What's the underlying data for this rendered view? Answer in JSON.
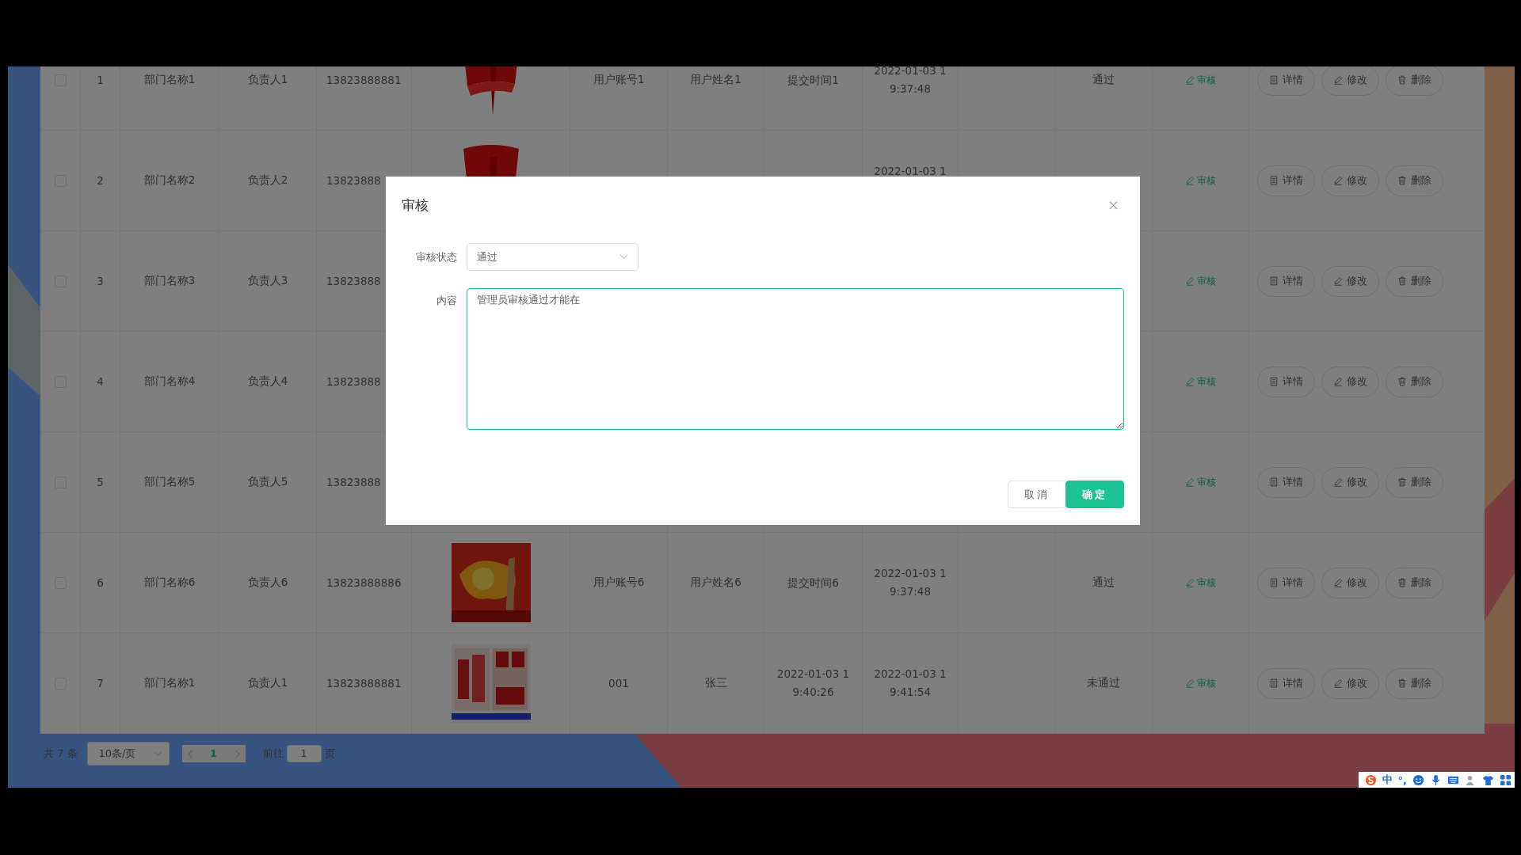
{
  "table": {
    "rows": [
      {
        "checked": false,
        "index": "1",
        "dept": "部门名称1",
        "person": "负责人1",
        "phone": "13823888881",
        "image": {
          "kind": "picture"
        },
        "account": "用户账号1",
        "name": "用户姓名1",
        "submitted": [
          "提交时间1"
        ],
        "time": [
          "2022-01-03 1",
          "9:37:48"
        ],
        "status": "通过",
        "audit": "审核",
        "actions": [
          {
            "kind": "detail",
            "label": "详情"
          },
          {
            "kind": "edit",
            "label": "修改"
          },
          {
            "kind": "delete",
            "label": "删除"
          }
        ]
      },
      {
        "checked": false,
        "index": "2",
        "dept": "部门名称2",
        "person": "负责人2",
        "phone": "13823888",
        "image": {
          "kind": "picture"
        },
        "time": [
          "2022-01-03 1"
        ],
        "audit": "审核",
        "actions": [
          {
            "kind": "detail",
            "label": "详情"
          },
          {
            "kind": "edit",
            "label": "修改"
          },
          {
            "kind": "delete",
            "label": "删除"
          }
        ]
      },
      {
        "checked": false,
        "index": "3",
        "dept": "部门名称3",
        "person": "负责人3",
        "phone": "13823888",
        "audit": "审核",
        "actions": [
          {
            "kind": "detail",
            "label": "详情"
          },
          {
            "kind": "edit",
            "label": "修改"
          },
          {
            "kind": "delete",
            "label": "删除"
          }
        ]
      },
      {
        "checked": false,
        "index": "4",
        "dept": "部门名称4",
        "person": "负责人4",
        "phone": "13823888",
        "audit": "审核",
        "actions": [
          {
            "kind": "detail",
            "label": "详情"
          },
          {
            "kind": "edit",
            "label": "修改"
          },
          {
            "kind": "delete",
            "label": "删除"
          }
        ]
      },
      {
        "checked": false,
        "index": "5",
        "dept": "部门名称5",
        "person": "负责人5",
        "phone": "13823888",
        "audit": "审核",
        "actions": [
          {
            "kind": "detail",
            "label": "详情"
          },
          {
            "kind": "edit",
            "label": "修改"
          },
          {
            "kind": "delete",
            "label": "删除"
          }
        ]
      },
      {
        "checked": false,
        "index": "6",
        "dept": "部门名称6",
        "person": "负责人6",
        "phone": "13823888886",
        "image": {
          "kind": "picture"
        },
        "account": "用户账号6",
        "name": "用户姓名6",
        "submitted": [
          "提交时间6"
        ],
        "time": [
          "2022-01-03 1",
          "9:37:48"
        ],
        "status": "通过",
        "audit": "审核",
        "actions": [
          {
            "kind": "detail",
            "label": "详情"
          },
          {
            "kind": "edit",
            "label": "修改"
          },
          {
            "kind": "delete",
            "label": "删除"
          }
        ]
      },
      {
        "checked": false,
        "index": "7",
        "dept": "部门名称1",
        "person": "负责人1",
        "phone": "13823888881",
        "image": {
          "kind": "picture"
        },
        "account": "001",
        "name": "张三",
        "submitted": [
          "2022-01-03 1",
          "9:40:26"
        ],
        "time": [
          "2022-01-03 1",
          "9:41:54"
        ],
        "status": "未通过",
        "audit": "审核",
        "actions": [
          {
            "kind": "detail",
            "label": "详情"
          },
          {
            "kind": "edit",
            "label": "修改"
          },
          {
            "kind": "delete",
            "label": "删除"
          }
        ]
      }
    ]
  },
  "pagination": {
    "total": "共 7 条",
    "page_size": "10条/页",
    "current_page": "1",
    "goto_label": "前往",
    "goto_value": "1",
    "goto_suffix": "页"
  },
  "dialog": {
    "title": "审核",
    "status_label": "审核状态",
    "status_value": "通过",
    "content_label": "内容",
    "content_value": "管理员审核通过才能在",
    "cancel": "取消",
    "confirm": "确定"
  },
  "ime_toolbar": {
    "language": "中",
    "punctuation": "°,"
  }
}
